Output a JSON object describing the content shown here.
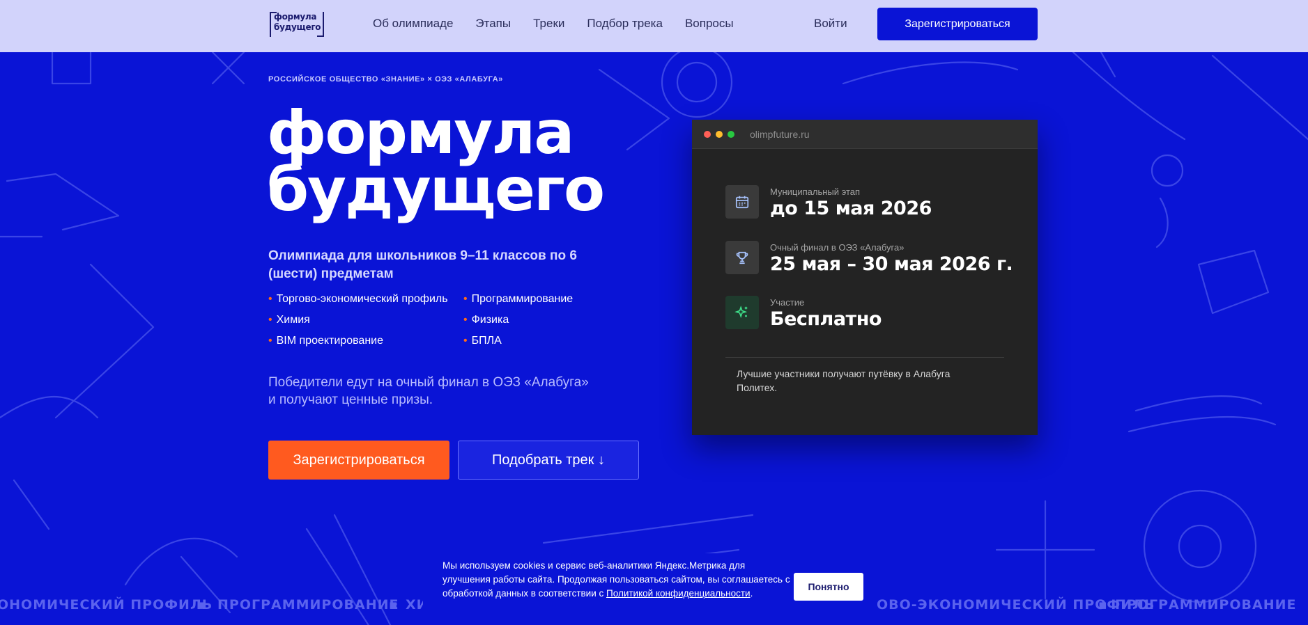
{
  "header": {
    "logo_line1": "формула",
    "logo_line2": "будущего",
    "nav": [
      "Об олимпиаде",
      "Этапы",
      "Треки",
      "Подбор трека",
      "Вопросы"
    ],
    "login_label": "Войти",
    "register_label": "Зарегистрироваться"
  },
  "hero": {
    "eyebrow": "РОССИЙСКОЕ ОБЩЕСТВО «ЗНАНИЕ» × ОЭЗ «АЛАБУГА»",
    "title_line1": "формула",
    "title_line2": "будущего",
    "subtitle": "Олимпиада для школьников 9–11 классов по 6 (шести) предметам",
    "subjects": [
      "Торгово-экономический профиль",
      "Программирование",
      "Химия",
      "Физика",
      "BIM проектирование",
      "БПЛА"
    ],
    "winners_text": "Победители едут на очный финал в ОЭЗ «Алабуга» и получают ценные призы.",
    "primary_button": "Зарегистрироваться",
    "secondary_button": "Подобрать трек ↓"
  },
  "card": {
    "url": "olimpfuture.ru",
    "rows": [
      {
        "label": "Муниципальный этап",
        "value": "до 15 мая 2026",
        "icon": "calendar-icon"
      },
      {
        "label": "Очный финал в ОЭЗ «Алабуга»",
        "value": "25 мая – 30 мая 2026 г.",
        "icon": "trophy-icon"
      },
      {
        "label": "Участие",
        "value": "Бесплатно",
        "icon": "sparkle-icon"
      }
    ],
    "note": "Лучшие участники получают путёвку в Алабуга Политех."
  },
  "ticker": {
    "left": "ОНОМИЧЕСКИЙ ПРОФИЛЬ",
    "mid1": "ПРОГРАММИРОВАНИЕ",
    "mid2": "ХИМ",
    "right1": "ОВО-ЭКОНОМИЧЕСКИЙ ПРОФИЛЬ",
    "right2": "ПРОГРАММИРОВАНИЕ"
  },
  "cookie": {
    "text_before": "Мы используем cookies и сервис веб-аналитики Яндекс.Метрика для улучшения работы сайта. Продолжая пользоваться сайтом, вы соглашаетесь с обработкой данных в соответствии с ",
    "link": "Политикой конфиденциальности",
    "text_after": ".",
    "button": "Понятно"
  },
  "colors": {
    "brand_blue": "#0a14d6",
    "accent_orange": "#ff5a1f",
    "header_bg": "#d2d3fb"
  }
}
